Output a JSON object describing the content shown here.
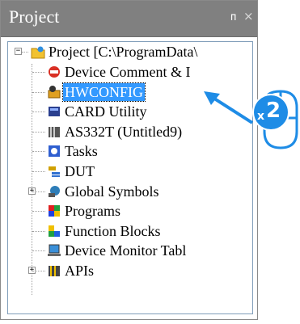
{
  "panel": {
    "title": "Project",
    "pin_glyph": "ᴨ",
    "close_glyph": "×"
  },
  "tree": {
    "root": {
      "label": "Project [C:\\ProgramData\\",
      "icon": "project-folder-icon",
      "expander": "⊟"
    },
    "items": [
      {
        "label": "Device Comment & I",
        "icon": "device-comment-icon"
      },
      {
        "label": "HWCONFIG",
        "icon": "hwconfig-icon",
        "selected": true
      },
      {
        "label": "CARD Utility",
        "icon": "card-utility-icon"
      },
      {
        "label": "AS332T  (Untitled9)",
        "icon": "plc-device-icon"
      },
      {
        "label": "Tasks",
        "icon": "tasks-icon"
      },
      {
        "label": "DUT",
        "icon": "dut-icon"
      },
      {
        "label": "Global Symbols",
        "icon": "global-symbols-icon",
        "expander": "+"
      },
      {
        "label": "Programs",
        "icon": "programs-icon"
      },
      {
        "label": "Function Blocks",
        "icon": "function-blocks-icon"
      },
      {
        "label": "Device Monitor Tabl",
        "icon": "device-monitor-icon"
      },
      {
        "label": "APIs",
        "icon": "apis-icon",
        "expander": "+"
      }
    ]
  },
  "annotation": {
    "click_count_prefix": "x",
    "click_count": "2",
    "accent_color": "#1e8ce6"
  }
}
